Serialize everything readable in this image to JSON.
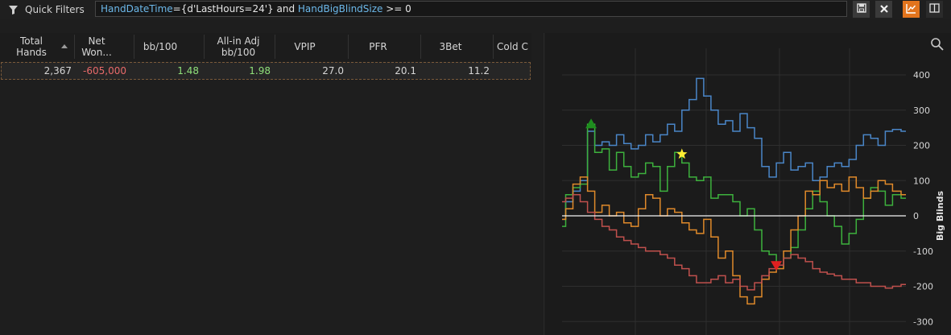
{
  "toolbar": {
    "quick_filters_label": "Quick Filters",
    "filter_expression": {
      "field1": "HandDateTime",
      "part1": "={d'LastHours=24'} and ",
      "field2": "HandBigBlindSize",
      "part2": " >= 0"
    },
    "buttons": [
      "save-icon",
      "clear-icon",
      "line-chart-icon",
      "split-view-icon"
    ],
    "accent_color": "#e2741d"
  },
  "grid": {
    "columns": [
      "Total Hands",
      "Net Won...",
      "bb/100",
      "All-in Adj bb/100",
      "VPIP",
      "PFR",
      "3Bet",
      "Cold C"
    ],
    "sorted_column": "Total Hands",
    "rows": [
      {
        "total_hands": "2,367",
        "net_won": "-605,000",
        "bb100": "1.48",
        "allin_adj": "1.98",
        "vpip": "27.0",
        "pfr": "20.1",
        "threebet": "11.2"
      }
    ],
    "colors": {
      "negative": "#e86a6a",
      "positive": "#8fe07a"
    }
  },
  "chart_data": {
    "type": "line",
    "ylabel": "Big Blinds",
    "ylim": [
      -300,
      400
    ],
    "yticks": [
      400,
      300,
      200,
      100,
      0,
      -100,
      -200,
      -300
    ],
    "grid": true,
    "x": [
      0,
      50,
      100,
      150,
      200,
      250,
      300,
      350,
      400,
      450,
      500,
      550,
      600,
      650,
      700,
      750,
      800,
      850,
      900,
      950,
      1000,
      1050,
      1100,
      1150,
      1200,
      1250,
      1300,
      1350,
      1400,
      1450,
      1500,
      1550,
      1600,
      1650,
      1700,
      1750,
      1800,
      1850,
      1900,
      1950,
      2000,
      2050,
      2100,
      2150,
      2200,
      2250,
      2300,
      2367
    ],
    "series": [
      {
        "color": "#4a86c8",
        "values": [
          -10,
          40,
          70,
          100,
          240,
          200,
          210,
          200,
          230,
          205,
          190,
          200,
          230,
          210,
          230,
          260,
          240,
          300,
          330,
          390,
          340,
          300,
          260,
          270,
          240,
          290,
          250,
          220,
          140,
          110,
          150,
          180,
          130,
          140,
          150,
          100,
          110,
          140,
          150,
          140,
          160,
          200,
          230,
          220,
          200,
          240,
          245,
          240
        ]
      },
      {
        "color": "#3db13d",
        "values": [
          -30,
          60,
          80,
          90,
          260,
          180,
          190,
          130,
          180,
          140,
          110,
          120,
          150,
          140,
          70,
          140,
          180,
          150,
          110,
          100,
          110,
          50,
          60,
          60,
          40,
          0,
          20,
          -40,
          -100,
          -110,
          -140,
          -120,
          -90,
          -40,
          20,
          70,
          40,
          0,
          -30,
          -80,
          -50,
          -10,
          50,
          80,
          70,
          30,
          60,
          50
        ]
      },
      {
        "color": "#e08a2a",
        "values": [
          -10,
          20,
          90,
          110,
          70,
          10,
          30,
          0,
          10,
          -20,
          -30,
          20,
          60,
          50,
          0,
          20,
          10,
          -20,
          -40,
          -50,
          -10,
          -60,
          -120,
          -100,
          -170,
          -230,
          -250,
          -230,
          -180,
          -160,
          -150,
          -100,
          -40,
          0,
          70,
          60,
          100,
          80,
          90,
          70,
          110,
          80,
          50,
          70,
          100,
          90,
          70,
          60
        ]
      },
      {
        "color": "#c0504d",
        "values": [
          40,
          50,
          60,
          40,
          10,
          -10,
          -30,
          -40,
          -60,
          -70,
          -80,
          -90,
          -100,
          -100,
          -110,
          -120,
          -140,
          -150,
          -170,
          -190,
          -190,
          -180,
          -170,
          -190,
          -180,
          -200,
          -210,
          -190,
          -170,
          -150,
          -140,
          -120,
          -110,
          -120,
          -130,
          -150,
          -160,
          -165,
          -170,
          -180,
          -180,
          -190,
          -190,
          -200,
          -200,
          -205,
          -200,
          -195
        ]
      }
    ],
    "zero_line": 0,
    "markers": [
      {
        "kind": "peak-up",
        "series": 1,
        "x": 200,
        "y": 260,
        "color": "#1e8e1e"
      },
      {
        "kind": "star",
        "series": 1,
        "x": 825,
        "y": 175,
        "color": "#ffee33"
      },
      {
        "kind": "trough-down",
        "series": 1,
        "x": 1475,
        "y": -140,
        "color": "#e02020"
      }
    ]
  }
}
